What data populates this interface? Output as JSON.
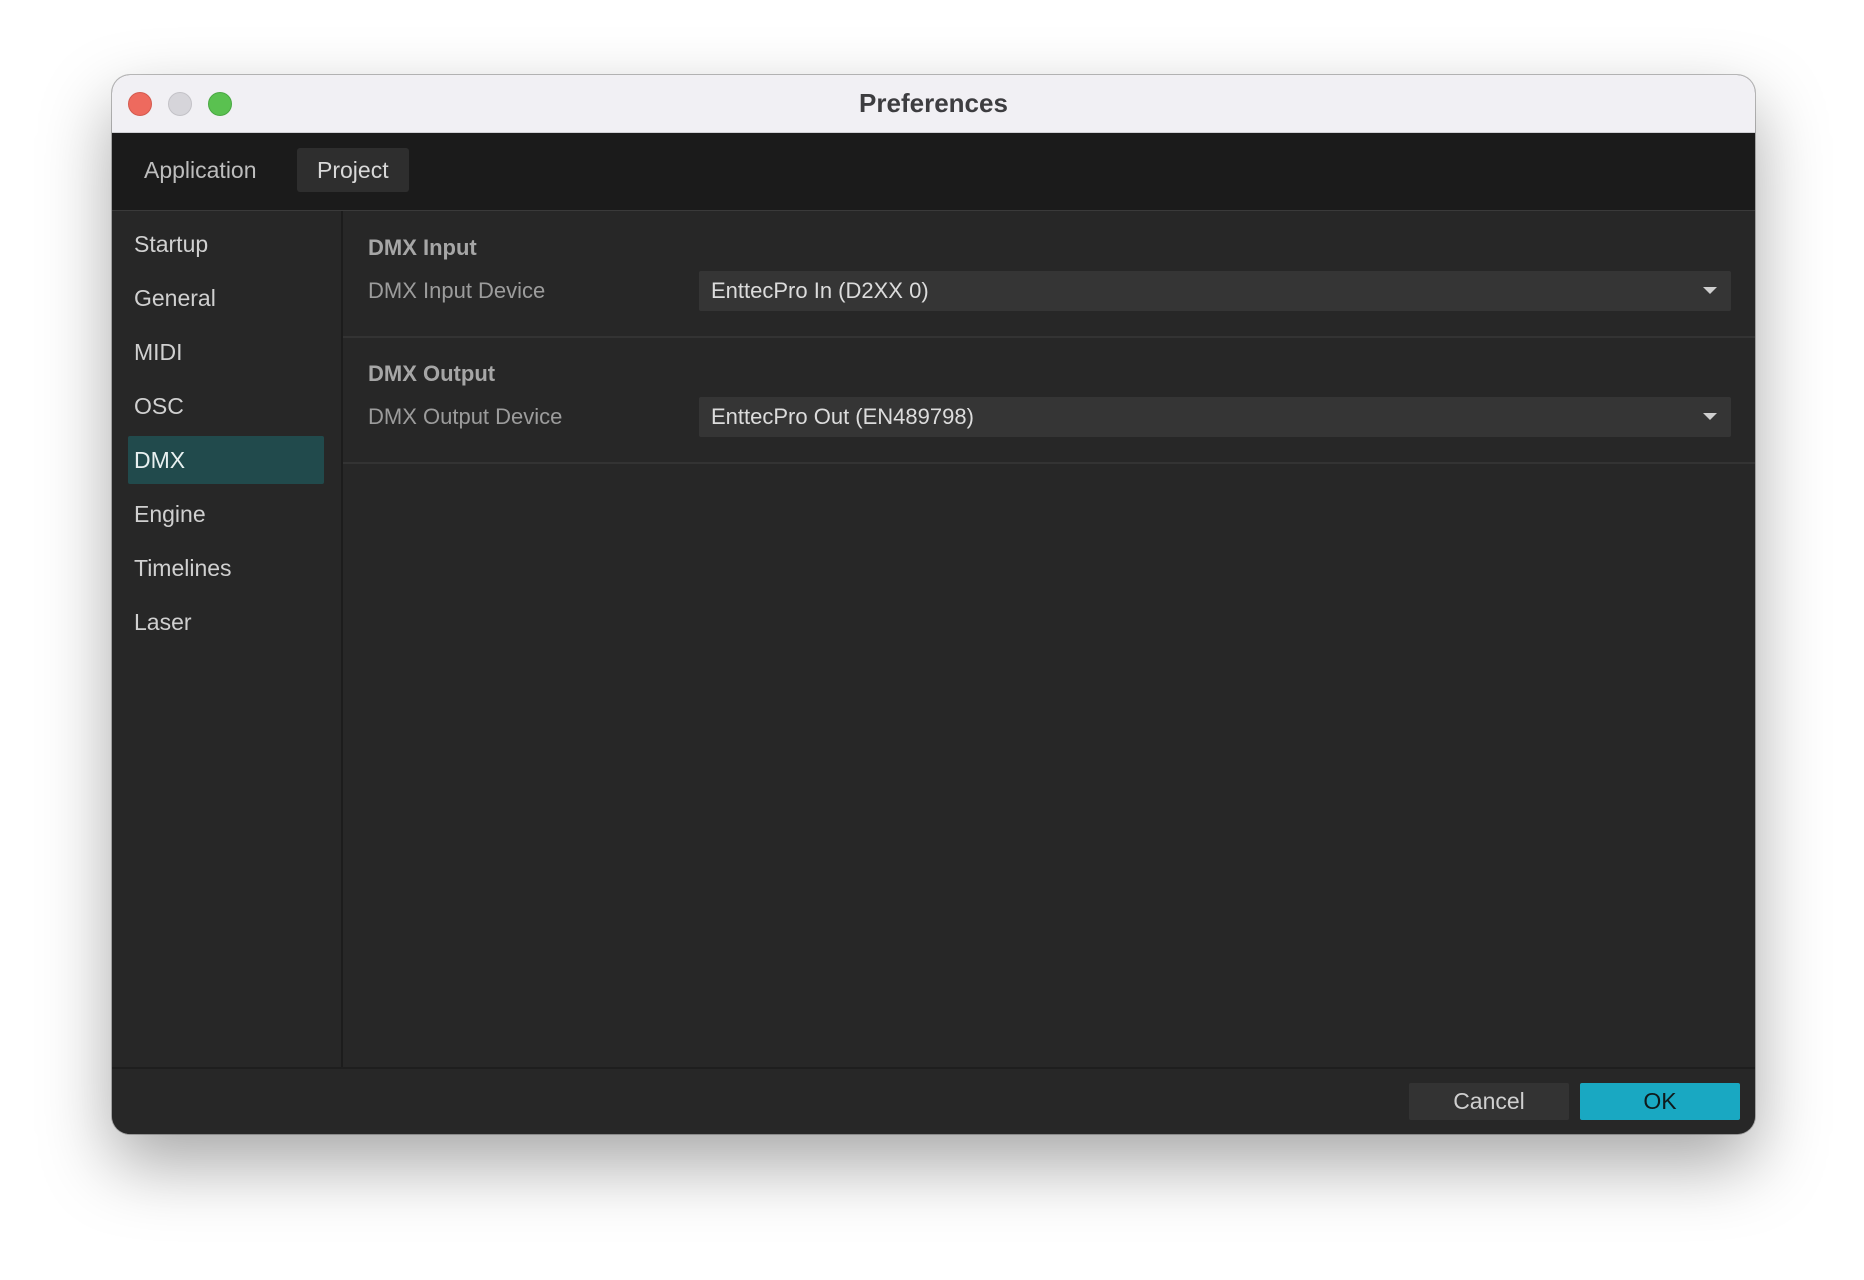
{
  "window": {
    "title": "Preferences"
  },
  "tabs": [
    {
      "label": "Application",
      "selected": false
    },
    {
      "label": "Project",
      "selected": true
    }
  ],
  "sidebar": {
    "items": [
      {
        "label": "Startup"
      },
      {
        "label": "General"
      },
      {
        "label": "MIDI"
      },
      {
        "label": "OSC"
      },
      {
        "label": "DMX",
        "selected": true
      },
      {
        "label": "Engine"
      },
      {
        "label": "Timelines"
      },
      {
        "label": "Laser"
      }
    ]
  },
  "sections": [
    {
      "title": "DMX Input",
      "field_label": "DMX Input Device",
      "value": "EnttecPro In (D2XX 0)"
    },
    {
      "title": "DMX Output",
      "field_label": "DMX Output Device",
      "value": "EnttecPro Out (EN489798)"
    }
  ],
  "footer": {
    "cancel_label": "Cancel",
    "ok_label": "OK"
  },
  "colors": {
    "accent": "#19a8c2",
    "selected_sidebar": "#214a4c"
  }
}
